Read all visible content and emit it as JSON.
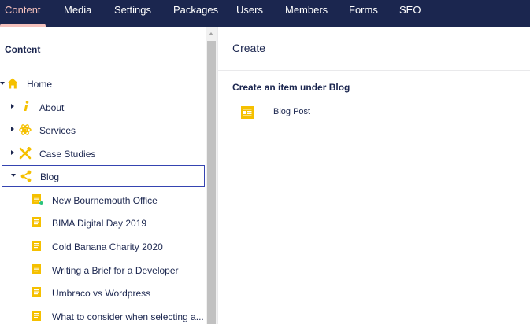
{
  "colors": {
    "topbar": "#1b264f",
    "active_tab": "#f5c1bc",
    "icon_yellow": "#f5c000",
    "text": "#1b264f",
    "selection_border": "#3544b1",
    "badge_green": "#2bc37c"
  },
  "nav": {
    "items": [
      {
        "label": "Content"
      },
      {
        "label": "Media"
      },
      {
        "label": "Settings"
      },
      {
        "label": "Packages"
      },
      {
        "label": "Users"
      },
      {
        "label": "Members"
      },
      {
        "label": "Forms"
      },
      {
        "label": "SEO"
      }
    ],
    "active": "Content"
  },
  "tree": {
    "heading": "Content",
    "nodes": [
      {
        "label": "Home",
        "icon": "home-icon",
        "expanded": true
      },
      {
        "label": "About",
        "icon": "info-icon"
      },
      {
        "label": "Services",
        "icon": "atom-icon"
      },
      {
        "label": "Case Studies",
        "icon": "tools-icon"
      },
      {
        "label": "Blog",
        "icon": "share-icon",
        "expanded": true,
        "selected": true
      },
      {
        "label": "New Bournemouth Office",
        "icon": "document-icon",
        "badge": "new-status-badge"
      },
      {
        "label": "BIMA Digital Day 2019",
        "icon": "document-icon"
      },
      {
        "label": "Cold Banana Charity 2020",
        "icon": "document-icon"
      },
      {
        "label": "Writing a Brief for a Developer",
        "icon": "document-icon"
      },
      {
        "label": "Umbraco vs Wordpress",
        "icon": "document-icon"
      },
      {
        "label": "What to consider when selecting a...",
        "icon": "document-icon"
      }
    ]
  },
  "main": {
    "title": "Create",
    "subheading": "Create an item under Blog",
    "options": [
      {
        "label": "Blog Post",
        "icon": "document-icon"
      }
    ]
  }
}
